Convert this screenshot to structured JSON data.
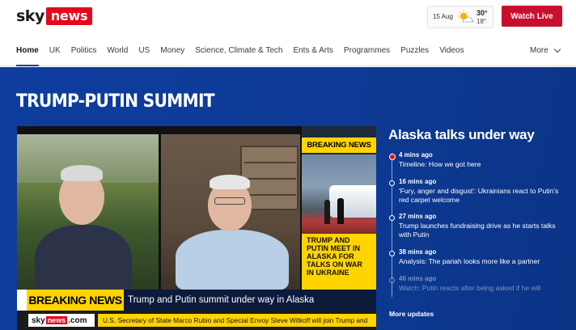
{
  "header": {
    "logo_sky": "sky",
    "logo_news": "news",
    "weather": {
      "date": "15 Aug",
      "high": "30°",
      "low": "18°",
      "icon": "sun-cloud-icon"
    },
    "watch_live": "Watch Live"
  },
  "nav": {
    "items": [
      {
        "label": "Home",
        "active": true
      },
      {
        "label": "UK"
      },
      {
        "label": "Politics"
      },
      {
        "label": "World"
      },
      {
        "label": "US"
      },
      {
        "label": "Money"
      },
      {
        "label": "Science, Climate & Tech"
      },
      {
        "label": "Ents & Arts"
      },
      {
        "label": "Programmes"
      },
      {
        "label": "Puzzles"
      },
      {
        "label": "Videos"
      }
    ],
    "more": "More"
  },
  "hero": {
    "title": "TRUMP-PUTIN SUMMIT",
    "video": {
      "side_tag": "BREAKING NEWS",
      "side_text": [
        "TRUMP AND",
        "PUTIN MEET IN",
        "ALASKA FOR",
        "TALKS ON WAR",
        "IN UKRAINE"
      ],
      "banner_label": "BREAKING NEWS",
      "banner_headline": "Trump and Putin summit under way in Alaska",
      "ticker_sky": "sky",
      "ticker_news": "news",
      "ticker_com": ".com",
      "ticker_text": "U.S. Secretary of State Marco Rubio and Special Envoy Steve Witkoff will join Trump and"
    }
  },
  "live": {
    "title": "Alaska talks under way",
    "updates": [
      {
        "time": "4 mins ago",
        "text": "Timeline: How we got here"
      },
      {
        "time": "16 mins ago",
        "text": "'Fury, anger and disgust': Ukrainians react to Putin's red carpet welcome"
      },
      {
        "time": "27 mins ago",
        "text": "Trump launches fundraising drive as he starts talks with Putin"
      },
      {
        "time": "38 mins ago",
        "text": "Analysis: The pariah looks more like a partner"
      },
      {
        "time": "46 mins ago",
        "text": "Watch: Putin reacts after being asked if he will"
      }
    ],
    "more": "More updates"
  },
  "colors": {
    "brand_red": "#e5081d",
    "hero_blue": "#0d3a95",
    "breaking_yellow": "#ffd400"
  }
}
